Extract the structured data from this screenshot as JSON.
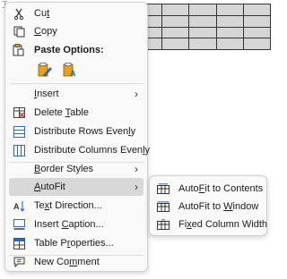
{
  "context_menu": {
    "cut": {
      "pre": "Cu",
      "acc": "t",
      "post": ""
    },
    "copy": {
      "pre": "",
      "acc": "C",
      "post": "opy"
    },
    "paste_options_label": "Paste Options:",
    "insert": {
      "pre": "",
      "acc": "I",
      "post": "nsert"
    },
    "delete_table": {
      "pre": "Delete ",
      "acc": "T",
      "post": "able"
    },
    "distribute_rows": {
      "pre": "Distribute Rows Even",
      "acc": "l",
      "post": "y"
    },
    "distribute_columns": {
      "pre": "Distribute Columns Even",
      "acc": "l",
      "post": "y"
    },
    "border_styles": {
      "pre": "",
      "acc": "B",
      "post": "order Styles"
    },
    "autofit": {
      "pre": "",
      "acc": "A",
      "post": "utoFit"
    },
    "text_direction": {
      "pre": "Te",
      "acc": "x",
      "post": "t Direction..."
    },
    "insert_caption": {
      "pre": "Insert ",
      "acc": "C",
      "post": "aption..."
    },
    "table_properties": {
      "pre": "Table P",
      "acc": "r",
      "post": "operties..."
    },
    "new_comment": {
      "pre": "New Co",
      "acc": "m",
      "post": "ment"
    }
  },
  "autofit_submenu": {
    "contents": {
      "pre": "Auto",
      "acc": "F",
      "post": "it to Contents"
    },
    "window": {
      "pre": "AutoFit to ",
      "acc": "W",
      "post": "indow"
    },
    "fixed": {
      "pre": "Fi",
      "acc": "x",
      "post": "ed Column Width"
    }
  },
  "colors": {
    "menu_bg": "#f9f9f9",
    "highlight": "#d8d8d8",
    "icon_blue": "#2b6cb0",
    "icon_orange": "#e8a21a"
  },
  "icons": [
    "scissors-icon",
    "copy-icon",
    "clipboard-icon",
    "paste-keep-formatting-icon",
    "paste-keep-text-icon",
    "delete-table-icon",
    "distribute-rows-icon",
    "distribute-columns-icon",
    "text-direction-icon",
    "insert-caption-icon",
    "table-properties-icon",
    "comment-icon",
    "autofit-contents-icon",
    "autofit-window-icon",
    "fixed-width-icon",
    "chevron-right-icon"
  ]
}
